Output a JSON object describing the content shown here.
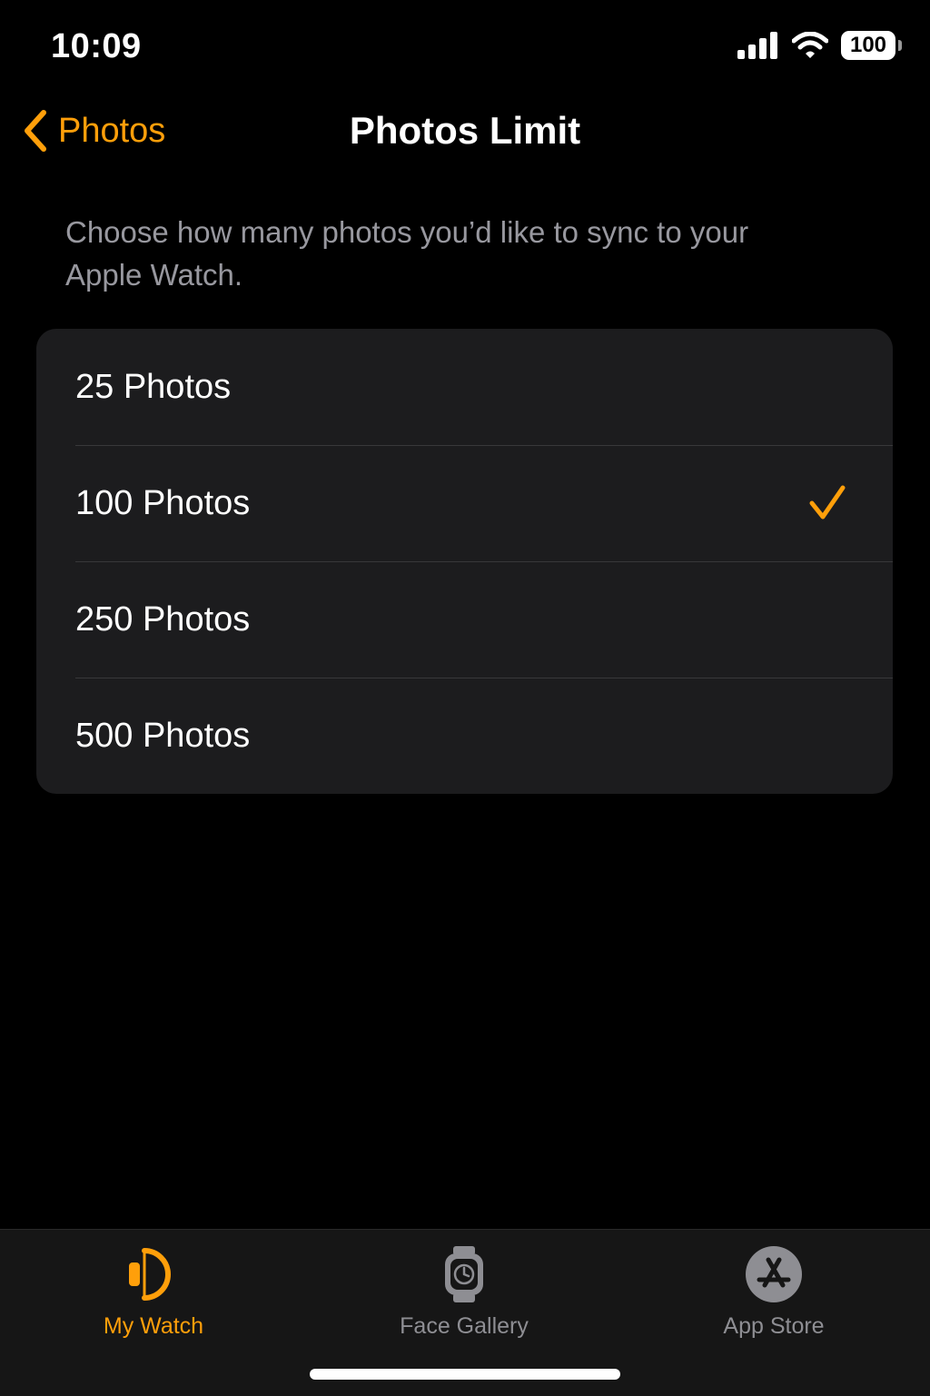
{
  "status_bar": {
    "time": "10:09",
    "battery_level": "100"
  },
  "nav": {
    "back_label": "Photos",
    "title": "Photos Limit"
  },
  "description": "Choose how many photos you’d like to sync to your Apple Watch.",
  "options": [
    {
      "label": "25 Photos",
      "selected": false
    },
    {
      "label": "100 Photos",
      "selected": true
    },
    {
      "label": "250 Photos",
      "selected": false
    },
    {
      "label": "500 Photos",
      "selected": false
    }
  ],
  "tabs": [
    {
      "label": "My Watch",
      "icon": "watch-icon",
      "active": true
    },
    {
      "label": "Face Gallery",
      "icon": "face-gallery-icon",
      "active": false
    },
    {
      "label": "App Store",
      "icon": "app-store-icon",
      "active": false
    }
  ],
  "colors": {
    "accent": "#ff9f0a",
    "background": "#000000",
    "group_background": "#1c1c1e",
    "secondary_text": "#98989f"
  }
}
